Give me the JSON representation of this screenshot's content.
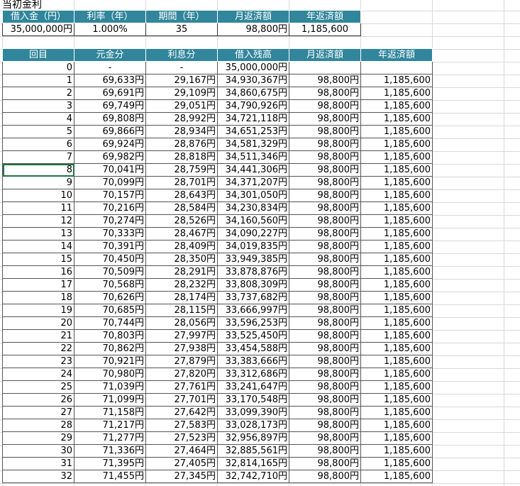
{
  "title": "当初金利",
  "summary": {
    "headers": [
      "借入金（円）",
      "利率（年）",
      "期間（年）",
      "月返済額",
      "年返済額"
    ],
    "values": [
      "35,000,000円",
      "1.000%",
      "35",
      "98,800円",
      "1,185,600"
    ]
  },
  "schedule": {
    "headers": [
      "回目",
      "元金分",
      "利息分",
      "借入残高",
      "月返済額",
      "年返済額"
    ],
    "rows": [
      [
        "0",
        "-",
        "-",
        "35,000,000円",
        "",
        ""
      ],
      [
        "1",
        "69,633円",
        "29,167円",
        "34,930,367円",
        "98,800円",
        "1,185,600"
      ],
      [
        "2",
        "69,691円",
        "29,109円",
        "34,860,675円",
        "98,800円",
        "1,185,600"
      ],
      [
        "3",
        "69,749円",
        "29,051円",
        "34,790,926円",
        "98,800円",
        "1,185,600"
      ],
      [
        "4",
        "69,808円",
        "28,992円",
        "34,721,118円",
        "98,800円",
        "1,185,600"
      ],
      [
        "5",
        "69,866円",
        "28,934円",
        "34,651,253円",
        "98,800円",
        "1,185,600"
      ],
      [
        "6",
        "69,924円",
        "28,876円",
        "34,581,329円",
        "98,800円",
        "1,185,600"
      ],
      [
        "7",
        "69,982円",
        "28,818円",
        "34,511,346円",
        "98,800円",
        "1,185,600"
      ],
      [
        "8",
        "70,041円",
        "28,759円",
        "34,441,306円",
        "98,800円",
        "1,185,600"
      ],
      [
        "9",
        "70,099円",
        "28,701円",
        "34,371,207円",
        "98,800円",
        "1,185,600"
      ],
      [
        "10",
        "70,157円",
        "28,643円",
        "34,301,050円",
        "98,800円",
        "1,185,600"
      ],
      [
        "11",
        "70,216円",
        "28,584円",
        "34,230,834円",
        "98,800円",
        "1,185,600"
      ],
      [
        "12",
        "70,274円",
        "28,526円",
        "34,160,560円",
        "98,800円",
        "1,185,600"
      ],
      [
        "13",
        "70,333円",
        "28,467円",
        "34,090,227円",
        "98,800円",
        "1,185,600"
      ],
      [
        "14",
        "70,391円",
        "28,409円",
        "34,019,835円",
        "98,800円",
        "1,185,600"
      ],
      [
        "15",
        "70,450円",
        "28,350円",
        "33,949,385円",
        "98,800円",
        "1,185,600"
      ],
      [
        "16",
        "70,509円",
        "28,291円",
        "33,878,876円",
        "98,800円",
        "1,185,600"
      ],
      [
        "17",
        "70,568円",
        "28,232円",
        "33,808,309円",
        "98,800円",
        "1,185,600"
      ],
      [
        "18",
        "70,626円",
        "28,174円",
        "33,737,682円",
        "98,800円",
        "1,185,600"
      ],
      [
        "19",
        "70,685円",
        "28,115円",
        "33,666,997円",
        "98,800円",
        "1,185,600"
      ],
      [
        "20",
        "70,744円",
        "28,056円",
        "33,596,253円",
        "98,800円",
        "1,185,600"
      ],
      [
        "21",
        "70,803円",
        "27,997円",
        "33,525,450円",
        "98,800円",
        "1,185,600"
      ],
      [
        "22",
        "70,862円",
        "27,938円",
        "33,454,588円",
        "98,800円",
        "1,185,600"
      ],
      [
        "23",
        "70,921円",
        "27,879円",
        "33,383,666円",
        "98,800円",
        "1,185,600"
      ],
      [
        "24",
        "70,980円",
        "27,820円",
        "33,312,686円",
        "98,800円",
        "1,185,600"
      ],
      [
        "25",
        "71,039円",
        "27,761円",
        "33,241,647円",
        "98,800円",
        "1,185,600"
      ],
      [
        "26",
        "71,099円",
        "27,701円",
        "33,170,548円",
        "98,800円",
        "1,185,600"
      ],
      [
        "27",
        "71,158円",
        "27,642円",
        "33,099,390円",
        "98,800円",
        "1,185,600"
      ],
      [
        "28",
        "71,217円",
        "27,583円",
        "33,028,173円",
        "98,800円",
        "1,185,600"
      ],
      [
        "29",
        "71,277円",
        "27,523円",
        "32,956,897円",
        "98,800円",
        "1,185,600"
      ],
      [
        "30",
        "71,336円",
        "27,464円",
        "32,885,561円",
        "98,800円",
        "1,185,600"
      ],
      [
        "31",
        "71,395円",
        "27,405円",
        "32,814,165円",
        "98,800円",
        "1,185,600"
      ],
      [
        "32",
        "71,455円",
        "27,345円",
        "32,742,710円",
        "98,800円",
        "1,185,600"
      ]
    ]
  },
  "colors": {
    "header_bg": "#31869b",
    "selection": "#217346"
  }
}
